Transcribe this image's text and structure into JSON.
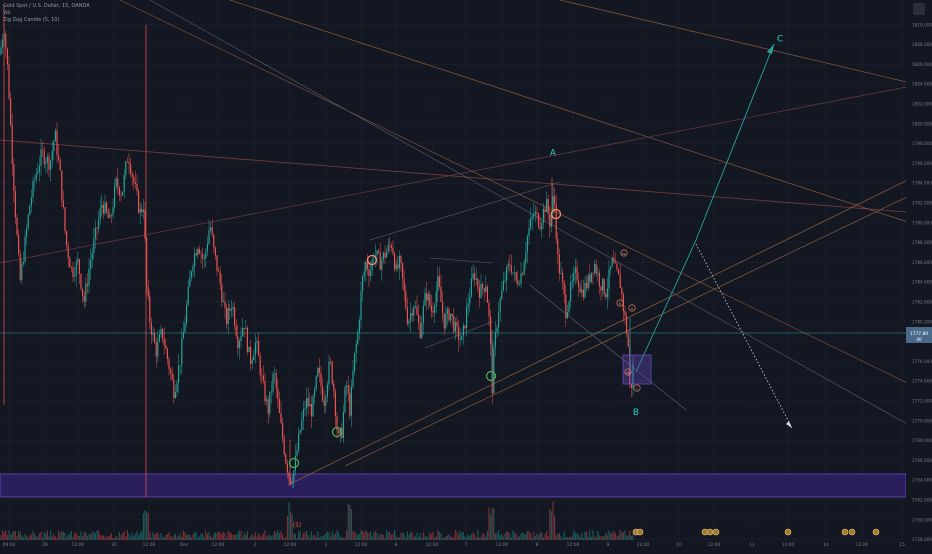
{
  "legend": {
    "symbol_line": "Gold Spot / U.S. Dollar, 15, OANDA",
    "volume_line": "Vol",
    "indicator_line": "Zig Zag Candle (5, 10)"
  },
  "colors": {
    "background": "#131722",
    "grid": "#1e222d",
    "axis_text": "#787b86",
    "bull": "#26a69a",
    "bear": "#ef5350",
    "trend_orange": "#8d5a3c",
    "trend_red": "#6e3a3e",
    "trend_gray": "#5d606b",
    "zone_fill": "#2a1f5c",
    "zone_border": "#6a4bc4",
    "label_teal": "#2ad1c9",
    "circle_green": "#4caf50",
    "circle_orange": "#ff8a65",
    "price_tag": "#4a6a8a"
  },
  "price_tag": {
    "value": "1777.89",
    "sub": "00"
  },
  "chart_data": {
    "type": "candlestick",
    "symbol": "Gold Spot / U.S. Dollar",
    "interval": "15",
    "source": "OANDA",
    "y_axis": {
      "range": [
        1757,
        1812
      ],
      "tick_labels": [
        "1810.000",
        "1808.000",
        "1806.000",
        "1804.000",
        "1802.000",
        "1800.000",
        "1798.000",
        "1796.000",
        "1794.000",
        "1792.000",
        "1790.000",
        "1788.000",
        "1786.000",
        "1784.000",
        "1782.000",
        "1780.000",
        "1778.000",
        "1776.000",
        "1774.000",
        "1772.000",
        "1770.000",
        "1768.000",
        "1766.000",
        "1764.000",
        "1762.000",
        "1760.000",
        "1758.000"
      ]
    },
    "x_axis": {
      "tick_labels": [
        "09:00",
        "29",
        "12:00",
        "30",
        "12:00",
        "Dec",
        "12:00",
        "2",
        "12:00",
        "3",
        "12:00",
        "6",
        "12:00",
        "7",
        "12:00",
        "8",
        "12:00",
        "9",
        "12:00",
        "10",
        "12:00",
        "13",
        "12:00",
        "14",
        "12:00",
        "15"
      ]
    },
    "price_path": [
      [
        0,
        1807
      ],
      [
        4,
        1810
      ],
      [
        8,
        1805
      ],
      [
        12,
        1797
      ],
      [
        16,
        1790
      ],
      [
        20,
        1784
      ],
      [
        25,
        1788
      ],
      [
        30,
        1792
      ],
      [
        36,
        1795
      ],
      [
        42,
        1797
      ],
      [
        50,
        1796
      ],
      [
        55,
        1799
      ],
      [
        60,
        1795
      ],
      [
        66,
        1788
      ],
      [
        72,
        1785
      ],
      [
        78,
        1786
      ],
      [
        84,
        1782
      ],
      [
        90,
        1786
      ],
      [
        96,
        1789
      ],
      [
        102,
        1792
      ],
      [
        110,
        1790
      ],
      [
        116,
        1794
      ],
      [
        122,
        1793
      ],
      [
        128,
        1797
      ],
      [
        134,
        1794
      ],
      [
        140,
        1791
      ],
      [
        144,
        1792
      ],
      [
        146,
        1784
      ],
      [
        150,
        1780
      ],
      [
        156,
        1777
      ],
      [
        162,
        1779
      ],
      [
        168,
        1776
      ],
      [
        174,
        1773
      ],
      [
        180,
        1776
      ],
      [
        186,
        1781
      ],
      [
        192,
        1786
      ],
      [
        198,
        1788
      ],
      [
        204,
        1786
      ],
      [
        210,
        1790
      ],
      [
        214,
        1787
      ],
      [
        220,
        1784
      ],
      [
        226,
        1780
      ],
      [
        232,
        1782
      ],
      [
        238,
        1778
      ],
      [
        244,
        1780
      ],
      [
        250,
        1776
      ],
      [
        256,
        1778
      ],
      [
        262,
        1774
      ],
      [
        268,
        1771
      ],
      [
        274,
        1775
      ],
      [
        280,
        1770
      ],
      [
        286,
        1766
      ],
      [
        290,
        1764
      ],
      [
        294,
        1765
      ],
      [
        300,
        1769
      ],
      [
        306,
        1772
      ],
      [
        312,
        1771
      ],
      [
        318,
        1775
      ],
      [
        324,
        1772
      ],
      [
        330,
        1776
      ],
      [
        334,
        1773
      ],
      [
        338,
        1768
      ],
      [
        342,
        1769
      ],
      [
        346,
        1774
      ],
      [
        350,
        1771
      ],
      [
        354,
        1776
      ],
      [
        358,
        1779
      ],
      [
        362,
        1784
      ],
      [
        366,
        1786
      ],
      [
        370,
        1785
      ],
      [
        374,
        1787
      ],
      [
        380,
        1786
      ],
      [
        386,
        1787
      ],
      [
        392,
        1788
      ],
      [
        396,
        1785
      ],
      [
        400,
        1786
      ],
      [
        404,
        1783
      ],
      [
        408,
        1780
      ],
      [
        414,
        1782
      ],
      [
        420,
        1779
      ],
      [
        426,
        1783
      ],
      [
        432,
        1781
      ],
      [
        438,
        1784
      ],
      [
        444,
        1780
      ],
      [
        450,
        1781
      ],
      [
        456,
        1779
      ],
      [
        462,
        1778
      ],
      [
        468,
        1782
      ],
      [
        474,
        1785
      ],
      [
        480,
        1783
      ],
      [
        486,
        1784
      ],
      [
        490,
        1779
      ],
      [
        492,
        1773
      ],
      [
        494,
        1777
      ],
      [
        498,
        1781
      ],
      [
        504,
        1784
      ],
      [
        510,
        1786
      ],
      [
        516,
        1784
      ],
      [
        522,
        1785
      ],
      [
        528,
        1789
      ],
      [
        534,
        1791
      ],
      [
        540,
        1790
      ],
      [
        546,
        1792
      ],
      [
        550,
        1790
      ],
      [
        554,
        1793
      ],
      [
        558,
        1786
      ],
      [
        562,
        1784
      ],
      [
        566,
        1781
      ],
      [
        570,
        1783
      ],
      [
        576,
        1785
      ],
      [
        582,
        1783
      ],
      [
        588,
        1784
      ],
      [
        594,
        1786
      ],
      [
        600,
        1784
      ],
      [
        606,
        1783
      ],
      [
        612,
        1786
      ],
      [
        616,
        1785
      ],
      [
        620,
        1784
      ],
      [
        624,
        1781
      ],
      [
        628,
        1778
      ],
      [
        630,
        1773
      ],
      [
        632,
        1774
      ],
      [
        634,
        1777
      ]
    ],
    "wave_labels": [
      {
        "text": "A",
        "price": 1796.8
      },
      {
        "text": "B",
        "price": 1770.6
      },
      {
        "text": "C",
        "price": 1808.3
      }
    ],
    "sub_wave_labels": [
      "iv",
      "v",
      "iii",
      "ii",
      "i",
      "(5)"
    ],
    "projection": {
      "from": 1774,
      "to": 1808
    }
  }
}
